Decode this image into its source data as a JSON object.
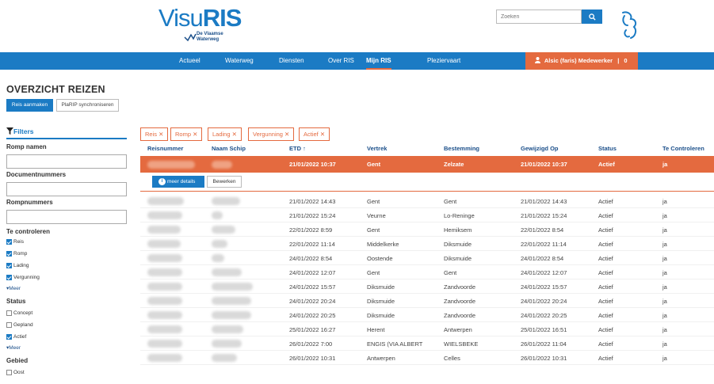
{
  "header": {
    "logo_text_main": "Visu",
    "logo_text_bold": "RIS",
    "logo_sub_line1": "De Vlaamse",
    "logo_sub_line2": "Waterweg",
    "search_placeholder": "Zoeken",
    "search_icon": "search-icon",
    "brand_logo_icon": "flemish-lion-icon"
  },
  "nav": {
    "items": [
      {
        "label": "Actueel"
      },
      {
        "label": "Waterweg"
      },
      {
        "label": "Diensten"
      },
      {
        "label": "Over RIS"
      },
      {
        "label": "Mijn RIS",
        "active": true
      },
      {
        "label": "Plezier­vaart"
      }
    ],
    "user_label": "Alsic (faris) Medewerker",
    "user_count": "0",
    "user_icon": "user-icon"
  },
  "page": {
    "title": "OVERZICHT REIZEN",
    "create_button": "Reis aanmaken",
    "sync_button": "PlaRIP synchroniseren"
  },
  "filters": {
    "title": "Filters",
    "romp_namen_label": "Romp namen",
    "documentnummers_label": "Documentnummers",
    "rompnummers_label": "Rompnummers",
    "te_controleren_label": "Te controleren",
    "te_controleren_options": [
      {
        "label": "Reis",
        "checked": true
      },
      {
        "label": "Romp",
        "checked": true
      },
      {
        "label": "Lading",
        "checked": true
      },
      {
        "label": "Vergunning",
        "checked": true
      }
    ],
    "meer_label": "Meer",
    "status_label": "Status",
    "status_options": [
      {
        "label": "Concept",
        "checked": false
      },
      {
        "label": "Gepland",
        "checked": false
      },
      {
        "label": "Actief",
        "checked": true
      }
    ],
    "gebied_label": "Gebied",
    "gebied_options": [
      {
        "label": "Oost",
        "checked": false
      }
    ]
  },
  "active_tags": [
    "Reis",
    "Romp",
    "Lading",
    "Vergunning",
    "Actief"
  ],
  "table": {
    "columns": [
      "Reisnummer",
      "Naam Schip",
      "ETD ↑",
      "Vertrek",
      "Bestemming",
      "Gewijzigd Op",
      "Status",
      "Te Controleren"
    ],
    "selected_row": {
      "etd": "21/01/2022 10:37",
      "vertrek": "Gent",
      "bestemming": "Zelzate",
      "gewijzigd": "21/01/2022 10:37",
      "status": "Actief",
      "controleren": "ja"
    },
    "meer_details_button": "meer details",
    "bewerken_button": "Bewerken",
    "rows": [
      {
        "etd": "21/01/2022 14:43",
        "vertrek": "Gent",
        "bestemming": "Gent",
        "gewijzigd": "21/01/2022 14:43",
        "status": "Actief",
        "controleren": "ja"
      },
      {
        "etd": "21/01/2022 15:24",
        "vertrek": "Veurne",
        "bestemming": "Lo-Reninge",
        "gewijzigd": "21/01/2022 15:24",
        "status": "Actief",
        "controleren": "ja"
      },
      {
        "etd": "22/01/2022 8:59",
        "vertrek": "Gent",
        "bestemming": "Hemiksem",
        "gewijzigd": "22/01/2022 8:54",
        "status": "Actief",
        "controleren": "ja"
      },
      {
        "etd": "22/01/2022 11:14",
        "vertrek": "Middelkerke",
        "bestemming": "Diksmuide",
        "gewijzigd": "22/01/2022 11:14",
        "status": "Actief",
        "controleren": "ja"
      },
      {
        "etd": "24/01/2022 8:54",
        "vertrek": "Oostende",
        "bestemming": "Diksmuide",
        "gewijzigd": "24/01/2022 8:54",
        "status": "Actief",
        "controleren": "ja"
      },
      {
        "etd": "24/01/2022 12:07",
        "vertrek": "Gent",
        "bestemming": "Gent",
        "gewijzigd": "24/01/2022 12:07",
        "status": "Actief",
        "controleren": "ja"
      },
      {
        "etd": "24/01/2022 15:57",
        "vertrek": "Diksmuide",
        "bestemming": "Zandvoorde",
        "gewijzigd": "24/01/2022 15:57",
        "status": "Actief",
        "controleren": "ja"
      },
      {
        "etd": "24/01/2022 20:24",
        "vertrek": "Diksmuide",
        "bestemming": "Zandvoorde",
        "gewijzigd": "24/01/2022 20:24",
        "status": "Actief",
        "controleren": "ja"
      },
      {
        "etd": "24/01/2022 20:25",
        "vertrek": "Diksmuide",
        "bestemming": "Zandvoorde",
        "gewijzigd": "24/01/2022 20:25",
        "status": "Actief",
        "controleren": "ja"
      },
      {
        "etd": "25/01/2022 16:27",
        "vertrek": "Herent",
        "bestemming": "Antwerpen",
        "gewijzigd": "25/01/2022 16:51",
        "status": "Actief",
        "controleren": "ja"
      },
      {
        "etd": "26/01/2022 7:00",
        "vertrek": "ENGIS (VIA ALBERT",
        "bestemming": "WIELSBEKE",
        "gewijzigd": "26/01/2022 11:04",
        "status": "Actief",
        "controleren": "ja"
      },
      {
        "etd": "26/01/2022 10:31",
        "vertrek": "Antwerpen",
        "bestemming": "Celles",
        "gewijzigd": "26/01/2022 10:31",
        "status": "Actief",
        "controleren": "ja"
      }
    ]
  },
  "colors": {
    "primary": "#1b7bc4",
    "accent": "#e46a3f",
    "header_text": "#1b4f8a"
  }
}
